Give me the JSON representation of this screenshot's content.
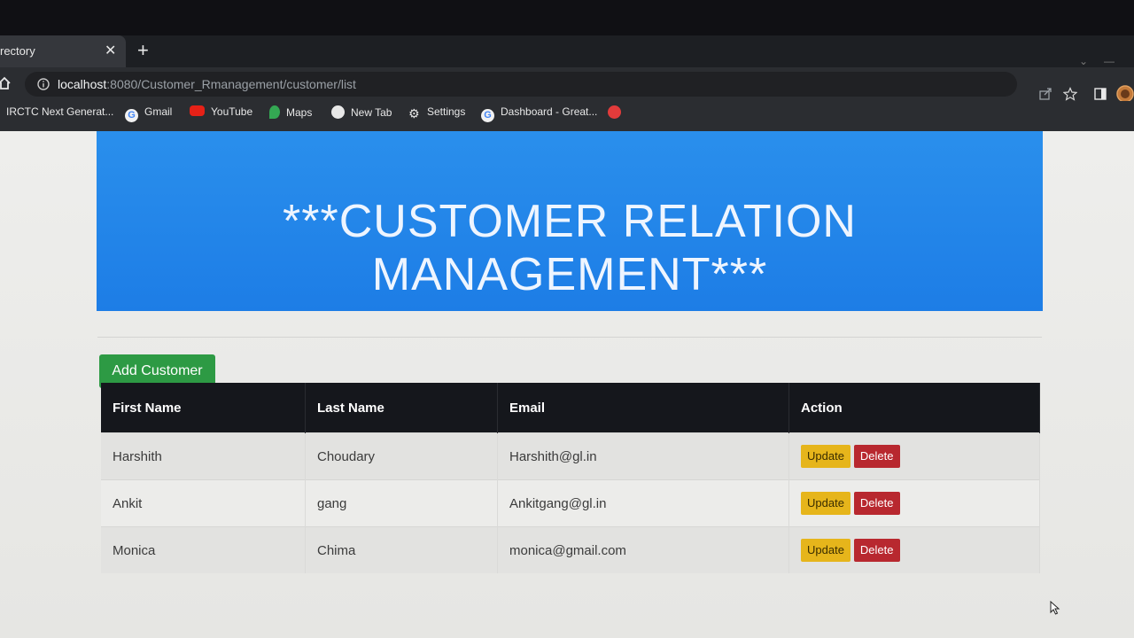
{
  "browser": {
    "tab_title": "rectory",
    "tab_close": "✕",
    "new_tab": "+",
    "url_host": "localhost",
    "url_rest": ":8080/Customer_Rmanagement/customer/list",
    "bookmarks": [
      "IRCTC Next Generat...",
      "Gmail",
      "YouTube",
      "Maps",
      "New Tab",
      "Settings",
      "Dashboard - Great..."
    ],
    "icons": [
      "home-icon",
      "info-icon",
      "share-icon",
      "star-icon",
      "sidebar-icon",
      "profile-icon"
    ]
  },
  "banner": {
    "title": "***CUSTOMER RELATION MANAGEMENT***",
    "color": "#1f82e8"
  },
  "actions": {
    "add_customer": "Add Customer"
  },
  "table": {
    "headers": [
      "First Name",
      "Last Name",
      "Email",
      "Action"
    ],
    "rows": [
      {
        "first": "Harshith",
        "last": "Choudary",
        "email": "Harshith@gl.in"
      },
      {
        "first": "Ankit",
        "last": "gang",
        "email": "Ankitgang@gl.in"
      },
      {
        "first": "Monica",
        "last": "Chima",
        "email": "monica@gmail.com"
      }
    ],
    "update_label": "Update",
    "delete_label": "Delete"
  },
  "colors": {
    "add_button": "#2d9a44",
    "update_button": "#e6b51b",
    "delete_button": "#b8282f",
    "table_header": "#15171c"
  }
}
